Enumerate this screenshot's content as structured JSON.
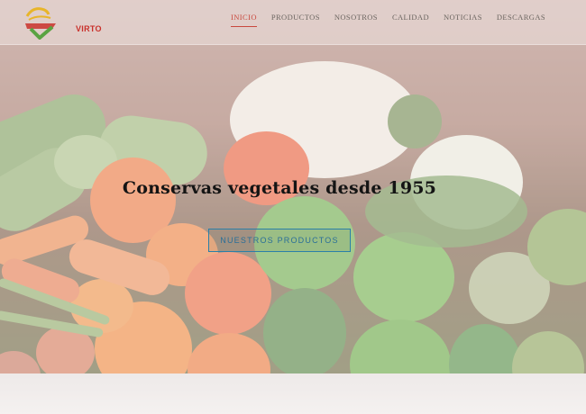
{
  "brand": {
    "logo_text": "VIRTO"
  },
  "nav": {
    "items": [
      {
        "label": "INICIO",
        "active": true
      },
      {
        "label": "PRODUCTOS"
      },
      {
        "label": "NOSOTROS"
      },
      {
        "label": "CALIDAD"
      },
      {
        "label": "NOTICIAS"
      },
      {
        "label": "DESCARGAS"
      }
    ]
  },
  "hero": {
    "tagline": "Conservas vegetales desde 1955",
    "cta_label": "NUESTROS PRODUCTOS"
  },
  "colors": {
    "accent_red": "#c9312b",
    "cta_blue": "#2a7fa8",
    "nav_text": "#6b6560"
  }
}
